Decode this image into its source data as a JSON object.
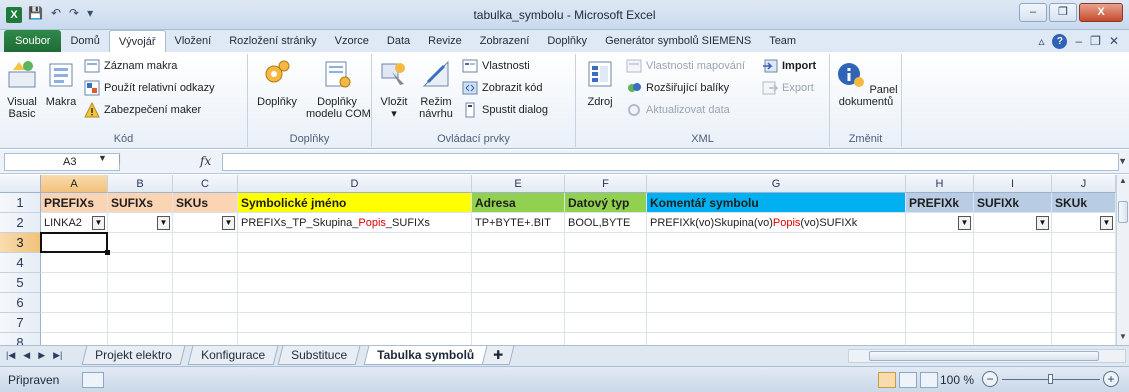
{
  "window": {
    "title": "tabulka_symbolu - Microsoft Excel",
    "minimize": "–",
    "restore": "❐",
    "close": "X"
  },
  "ribbon_tabs": [
    "Soubor",
    "Domů",
    "Vývojář",
    "Vložení",
    "Rozložení stránky",
    "Vzorce",
    "Data",
    "Revize",
    "Zobrazení",
    "Doplňky",
    "Generátor symbolů SIEMENS",
    "Team"
  ],
  "active_tab": "Vývojář",
  "ribbon": {
    "kod": {
      "label": "Kód",
      "visual_basic": "Visual\nBasic",
      "makra": "Makra",
      "zaznam_makra": "Záznam makra",
      "relativni_odkazy": "Použít relativní odkazy",
      "zabezpeceni": "Zabezpečení maker"
    },
    "doplnky": {
      "label": "Doplňky",
      "doplnky_btn": "Doplňky",
      "com_btn": "Doplňky\nmodelu COM"
    },
    "ovladaci_prvky": {
      "label": "Ovládací prvky",
      "vlozit": "Vložit",
      "rezim_navrhu": "Režim\nnávrhu",
      "vlastnosti": "Vlastnosti",
      "zobrazit_kod": "Zobrazit kód",
      "spustit_dialog": "Spustit dialog"
    },
    "xml": {
      "label": "XML",
      "zdroj": "Zdroj",
      "vlastnosti_mapovani": "Vlastnosti mapování",
      "rozsirujici_baliky": "Rozšiřující balíky",
      "aktualizovat_data": "Aktualizovat data",
      "import": "Import",
      "export": "Export"
    },
    "zmenit": {
      "label": "Změnit",
      "panel_dokumentu": "Panel\ndokumentů"
    }
  },
  "formula_bar": {
    "name_box": "A3",
    "fx": "fx",
    "formula": ""
  },
  "columns": [
    "A",
    "B",
    "C",
    "D",
    "E",
    "F",
    "G",
    "H",
    "I",
    "J"
  ],
  "rows": [
    "1",
    "2",
    "3",
    "4",
    "5",
    "6",
    "7",
    "8"
  ],
  "header_row": {
    "A": "PREFIXs",
    "B": "SUFIXs",
    "C": "SKUs",
    "D": "Symbolické jméno",
    "E": "Adresa",
    "F": "Datový typ",
    "G": "Komentář symbolu",
    "H": "PREFIXk",
    "I": "SUFIXk",
    "J": "SKUk"
  },
  "header_colors": {
    "A": "#fbd4b4",
    "B": "#fbd4b4",
    "C": "#fbd4b4",
    "D": "#ffff00",
    "E": "#92d050",
    "F": "#92d050",
    "G": "#00b0f0",
    "H": "#b8cce4",
    "I": "#b8cce4",
    "J": "#b8cce4"
  },
  "row2": {
    "A": "LINKA2",
    "D_pre": "PREFIXs_TP_Skupina_",
    "D_red": "Popis",
    "D_post": "_SUFIXs",
    "E": "TP+BYTE+.BIT",
    "F": "BOOL,BYTE",
    "G_pre": "PREFIXk(vo)Skupina(vo)",
    "G_red": "Popis",
    "G_post": "(vo)SUFIXk",
    "red_color": "#e00000"
  },
  "sheet_tabs": [
    "Projekt elektro",
    "Konfigurace",
    "Substituce",
    "Tabulka symbolů"
  ],
  "active_sheet": "Tabulka symbolů",
  "status": {
    "ready": "Připraven",
    "zoom": "100 %"
  },
  "zoom_fraction": 0.5,
  "colors": {
    "file_tab": "#1f6b35",
    "selection_header": "#f2c27a"
  }
}
